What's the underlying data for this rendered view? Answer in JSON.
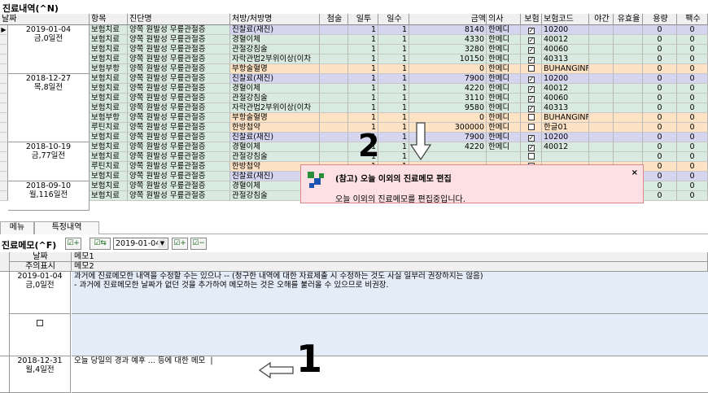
{
  "window_title": "진료내역(^N)",
  "grid": {
    "headers": [
      "날짜",
      "항목",
      "진단명",
      "처방/처방명",
      "첨술",
      "일투",
      "일수",
      "금액",
      "의사",
      "보험",
      "보험코드",
      "야간",
      "유효율",
      "용량",
      "팩수"
    ],
    "date_groups": [
      {
        "date": "2019-01-04",
        "sub": "금,0일전",
        "rows": 5
      },
      {
        "date": "2018-12-27",
        "sub": "목,8일전",
        "rows": 7
      },
      {
        "date": "2018-10-19",
        "sub": "금,77일전",
        "rows": 4
      },
      {
        "date": "2018-09-10",
        "sub": "월,116일전",
        "rows": 3
      }
    ],
    "rows": [
      {
        "cat": "보험치료",
        "dx": "양쪽 원발성 무릎관절증",
        "rx": "진찰료(재진)",
        "d1": "1",
        "d2": "1",
        "amt": "8140",
        "doc": "한메디",
        "ins": true,
        "code": "10200",
        "v1": "0",
        "v2": "0",
        "bg": "purple"
      },
      {
        "cat": "보험치료",
        "dx": "양쪽 원발성 무릎관절증",
        "rx": "경혈이체",
        "d1": "1",
        "d2": "1",
        "amt": "4330",
        "doc": "한메디",
        "ins": true,
        "code": "40012",
        "v1": "0",
        "v2": "0",
        "bg": "norm"
      },
      {
        "cat": "보험치료",
        "dx": "양쪽 원발성 무릎관절증",
        "rx": "관절강침술",
        "d1": "1",
        "d2": "1",
        "amt": "3280",
        "doc": "한메디",
        "ins": true,
        "code": "40060",
        "v1": "0",
        "v2": "0",
        "bg": "norm"
      },
      {
        "cat": "보험치료",
        "dx": "양쪽 원발성 무릎관절증",
        "rx": "자락관법2부위이상(이차",
        "d1": "1",
        "d2": "1",
        "amt": "10150",
        "doc": "한메디",
        "ins": true,
        "code": "40313",
        "v1": "0",
        "v2": "0",
        "bg": "norm"
      },
      {
        "cat": "보험부항",
        "dx": "양쪽 원발성 무릎관절증",
        "rx": "부항술혈명",
        "d1": "1",
        "d2": "1",
        "amt": "0",
        "doc": "한메디",
        "ins": false,
        "code": "BUHANGINFO",
        "v1": "0",
        "v2": "0",
        "bg": "orange"
      },
      {
        "cat": "보험치료",
        "dx": "양쪽 원발성 무릎관절증",
        "rx": "진찰료(재진)",
        "d1": "1",
        "d2": "1",
        "amt": "7900",
        "doc": "한메디",
        "ins": true,
        "code": "10200",
        "v1": "0",
        "v2": "0",
        "bg": "purple"
      },
      {
        "cat": "보험치료",
        "dx": "양쪽 원발성 무릎관절증",
        "rx": "경혈이체",
        "d1": "1",
        "d2": "1",
        "amt": "4220",
        "doc": "한메디",
        "ins": true,
        "code": "40012",
        "v1": "0",
        "v2": "0",
        "bg": "norm"
      },
      {
        "cat": "보험치료",
        "dx": "양쪽 원발성 무릎관절증",
        "rx": "관절강침술",
        "d1": "1",
        "d2": "1",
        "amt": "3110",
        "doc": "한메디",
        "ins": true,
        "code": "40060",
        "v1": "0",
        "v2": "0",
        "bg": "norm"
      },
      {
        "cat": "보험치료",
        "dx": "양쪽 원발성 무릎관절증",
        "rx": "자락관법2부위이상(이차",
        "d1": "1",
        "d2": "1",
        "amt": "9580",
        "doc": "한메디",
        "ins": true,
        "code": "40313",
        "v1": "0",
        "v2": "0",
        "bg": "norm"
      },
      {
        "cat": "보험부항",
        "dx": "양쪽 원발성 무릎관절증",
        "rx": "부항술혈명",
        "d1": "1",
        "d2": "1",
        "amt": "0",
        "doc": "한메디",
        "ins": false,
        "code": "BUHANGINFO",
        "v1": "0",
        "v2": "0",
        "bg": "orange"
      },
      {
        "cat": "루틴치료",
        "dx": "양쪽 원발성 무릎관절증",
        "rx": "한방첩약",
        "d1": "1",
        "d2": "1",
        "amt": "300000",
        "doc": "한메디",
        "ins": false,
        "code": "한글01",
        "v1": "0",
        "v2": "0",
        "bg": "orange"
      },
      {
        "cat": "보험치료",
        "dx": "양쪽 원발성 무릎관절증",
        "rx": "진찰료(재진)",
        "d1": "1",
        "d2": "1",
        "amt": "7900",
        "doc": "한메디",
        "ins": true,
        "code": "10200",
        "v1": "0",
        "v2": "0",
        "bg": "purple"
      },
      {
        "cat": "보험치료",
        "dx": "양쪽 원발성 무릎관절증",
        "rx": "경혈이체",
        "d1": "1",
        "d2": "1",
        "amt": "4220",
        "doc": "한메디",
        "ins": true,
        "code": "40012",
        "v1": "0",
        "v2": "0",
        "bg": "norm"
      },
      {
        "cat": "보험치료",
        "dx": "양쪽 원발성 무릎관절증",
        "rx": "관절강침술",
        "d1": "1",
        "d2": "1",
        "amt": "",
        "doc": "",
        "ins": false,
        "code": "",
        "v1": "0",
        "v2": "0",
        "bg": "norm"
      },
      {
        "cat": "루틴치료",
        "dx": "양쪽 원발성 무릎관절증",
        "rx": "한방첩약",
        "d1": "1",
        "d2": "1",
        "amt": "",
        "doc": "",
        "ins": false,
        "code": "",
        "v1": "0",
        "v2": "0",
        "bg": "orange"
      },
      {
        "cat": "보험치료",
        "dx": "양쪽 원발성 무릎관절증",
        "rx": "진찰료(재진)",
        "d1": "",
        "d2": "",
        "amt": "",
        "doc": "",
        "ins": false,
        "code": "",
        "v1": "0",
        "v2": "0",
        "bg": "purple"
      },
      {
        "cat": "보험치료",
        "dx": "양쪽 원발성 무릎관절증",
        "rx": "경혈이체",
        "d1": "1",
        "d2": "1",
        "amt": "4220",
        "doc": "한메디",
        "ins": true,
        "code": "40012",
        "v1": "0",
        "v2": "0",
        "bg": "norm"
      },
      {
        "cat": "보험치료",
        "dx": "양쪽 원발성 무릎관절증",
        "rx": "관절강침술",
        "d1": "1",
        "d2": "1",
        "amt": "3110",
        "doc": "한메디",
        "ins": true,
        "code": "40060",
        "v1": "0",
        "v2": "0",
        "bg": "norm"
      }
    ]
  },
  "tabs": [
    "메뉴",
    "특정내역"
  ],
  "memo": {
    "title": "진료메모(^F)",
    "date_value": "2019-01-04",
    "headers": {
      "date": "날짜",
      "memo1": "메모1",
      "flag": "주의표시",
      "memo2": "메모2"
    },
    "entries": [
      {
        "date": "2019-01-04",
        "sub": "금,0일전",
        "text": "과거에 진료메모한 내역을 수정할 수는 있으나 -- (청구한 내역에 대한 자료제출 시 수정하는 것도 사실 일부러 권장하지는 않음)\n- 과거에 진료메모한 날짜가 없던 것을 추가하여 메모하는 것은 오해를 불러올 수 있으므로 비권장."
      },
      {
        "date": "2018-12-31",
        "sub": "월,4일전",
        "text": "오늘 당일의 경과 예후 ... 등에 대한 메모"
      }
    ]
  },
  "popup": {
    "title": "(참고) 오늘 이외의 진료메모 편집",
    "message": "오늘 이외의 진료메모를 편집중입니다.",
    "close": "×"
  },
  "annotations": {
    "one": "1",
    "two": "2"
  },
  "colors": {
    "row_norm": "#d9ebe0",
    "row_orange": "#fde3c4",
    "row_purple": "#d5d5f0",
    "popup_bg": "#fde0e4",
    "memo_blue": "#e4ecf8"
  }
}
